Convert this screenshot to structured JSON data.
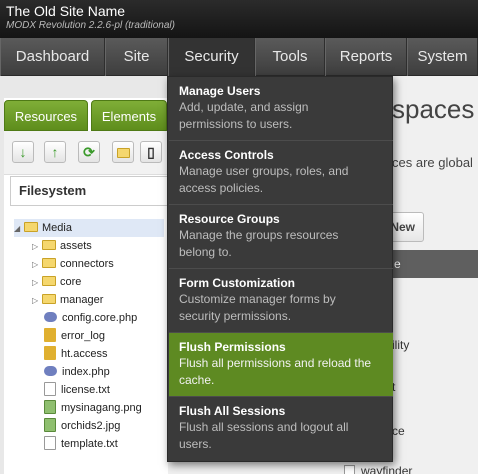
{
  "header": {
    "site_name": "The Old Site Name",
    "version": "MODX Revolution 2.2.6-pl (traditional)"
  },
  "nav": {
    "items": [
      {
        "label": "Dashboard"
      },
      {
        "label": "Site"
      },
      {
        "label": "Security"
      },
      {
        "label": "Tools"
      },
      {
        "label": "Reports"
      },
      {
        "label": "System"
      }
    ],
    "active": "Security"
  },
  "security_menu": {
    "items": [
      {
        "title": "Manage Users",
        "desc1": "Add, update, and assign",
        "desc2": "permissions to users."
      },
      {
        "title": "Access Controls",
        "desc1": "Manage user groups, roles, and",
        "desc2": "access policies."
      },
      {
        "title": "Resource Groups",
        "desc1": "Manage the groups resources",
        "desc2": "belong to."
      },
      {
        "title": "Form Customization",
        "desc1": "Customize manager forms by",
        "desc2": "security permissions."
      },
      {
        "title": "Flush Permissions",
        "desc1": "Flush all permissions and reload the",
        "desc2": "cache."
      },
      {
        "title": "Flush All Sessions",
        "desc1": "Flush all sessions and logout all",
        "desc2": "users."
      }
    ],
    "highlighted": "Flush Permissions"
  },
  "left_panel": {
    "tabs": [
      {
        "label": "Resources"
      },
      {
        "label": "Elements"
      }
    ],
    "filesystem_label": "Filesystem",
    "tree": {
      "root": "Media",
      "folders": [
        "assets",
        "connectors",
        "core",
        "manager"
      ],
      "files": [
        {
          "name": "config.core.php",
          "icon": "php-icon"
        },
        {
          "name": "error_log",
          "icon": "lock-icon"
        },
        {
          "name": "ht.access",
          "icon": "lock-icon"
        },
        {
          "name": "index.php",
          "icon": "php-icon"
        },
        {
          "name": "license.txt",
          "icon": "text-file-icon"
        },
        {
          "name": "mysinagang.png",
          "icon": "image-file-icon"
        },
        {
          "name": "orchids2.jpg",
          "icon": "image-file-icon"
        },
        {
          "name": "template.txt",
          "icon": "text-file-icon"
        }
      ]
    }
  },
  "main": {
    "heading_fragment": "spaces",
    "text_fragment": "ces are global",
    "new_button": "New",
    "grid_header_fragment": "e",
    "row_fragments": [
      "ility",
      "t",
      "ce"
    ],
    "visible_item": "wayfinder"
  },
  "colors": {
    "accent_green": "#5e8a22",
    "menu_bg": "#3a3a3a"
  }
}
